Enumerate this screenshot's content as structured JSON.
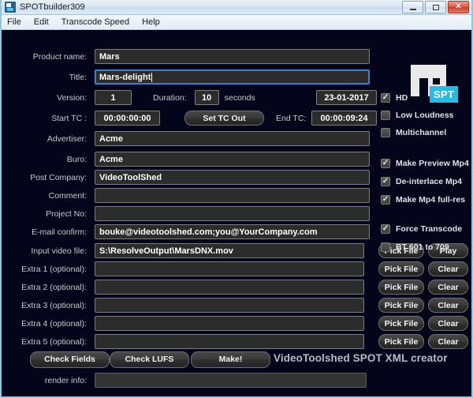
{
  "window": {
    "title": "SPOTbuilder309",
    "icon": "app-icon",
    "controls": {
      "minimize": "–",
      "maximize": "□",
      "close": "✕"
    }
  },
  "menu": {
    "items": [
      {
        "label": "File"
      },
      {
        "label": "Edit"
      },
      {
        "label": "Transcode Speed"
      },
      {
        "label": "Help"
      }
    ]
  },
  "form": {
    "product_name": {
      "label": "Product name:",
      "value": "Mars"
    },
    "title": {
      "label": "Title:",
      "value": "Mars-delight"
    },
    "version": {
      "label": "Version:",
      "value": "1"
    },
    "duration": {
      "label": "Duration:",
      "value": "10",
      "unit": "seconds"
    },
    "date": {
      "value": "23-01-2017"
    },
    "start_tc": {
      "label": "Start TC :",
      "value": "00:00:00:00"
    },
    "set_tc_out": {
      "label": "Set TC Out"
    },
    "end_tc": {
      "label": "End TC:",
      "value": "00:00:09:24"
    },
    "advertiser": {
      "label": "Advertiser:",
      "value": "Acme"
    },
    "buro": {
      "label": "Buro:",
      "value": "Acme"
    },
    "post_company": {
      "label": "Post Company:",
      "value": "VideoToolShed"
    },
    "comment": {
      "label": "Comment:",
      "value": ""
    },
    "project_no": {
      "label": "Project No:",
      "value": ""
    },
    "email_confirm": {
      "label": "E-mail confirm:",
      "value": "bouke@videotoolshed.com;you@YourCompany.com"
    },
    "input_video_file": {
      "label": "Input video file:",
      "value": "S:\\ResolveOutput\\MarsDNX.mov"
    },
    "extra1": {
      "label": "Extra 1 (optional):",
      "value": ""
    },
    "extra2": {
      "label": "Extra 2 (optional):",
      "value": ""
    },
    "extra3": {
      "label": "Extra 3 (optional):",
      "value": ""
    },
    "extra4": {
      "label": "Extra 4 (optional):",
      "value": ""
    },
    "extra5": {
      "label": "Extra 5 (optional):",
      "value": ""
    },
    "render_info": {
      "label": "render info:",
      "value": ""
    }
  },
  "file_buttons": {
    "pick_file": "Pick File",
    "play": "Play",
    "clear": "Clear"
  },
  "checkboxes": [
    {
      "label": "HD",
      "checked": true
    },
    {
      "label": "Low Loudness",
      "checked": false
    },
    {
      "label": "Multichannel",
      "checked": false
    },
    {
      "label": "Make Preview Mp4",
      "checked": true
    },
    {
      "label": "De-interlace Mp4",
      "checked": true
    },
    {
      "label": "Make Mp4  full-res",
      "checked": true
    },
    {
      "label": "Force Transcode",
      "checked": true
    },
    {
      "label": "BT 601 to 709",
      "checked": false
    }
  ],
  "actions": {
    "check_fields": "Check Fields",
    "check_lufs": "Check LUFS",
    "make": "Make!"
  },
  "branding": {
    "tagline": "VideoToolshed SPOT XML creator",
    "logo_text": "SPT"
  },
  "colors": {
    "background": "#04041a",
    "accent": "#2cb9e0",
    "field_bg": "#2c2c2c",
    "focus_border": "#3b8fd4",
    "window_border": "#8fc8e0"
  }
}
